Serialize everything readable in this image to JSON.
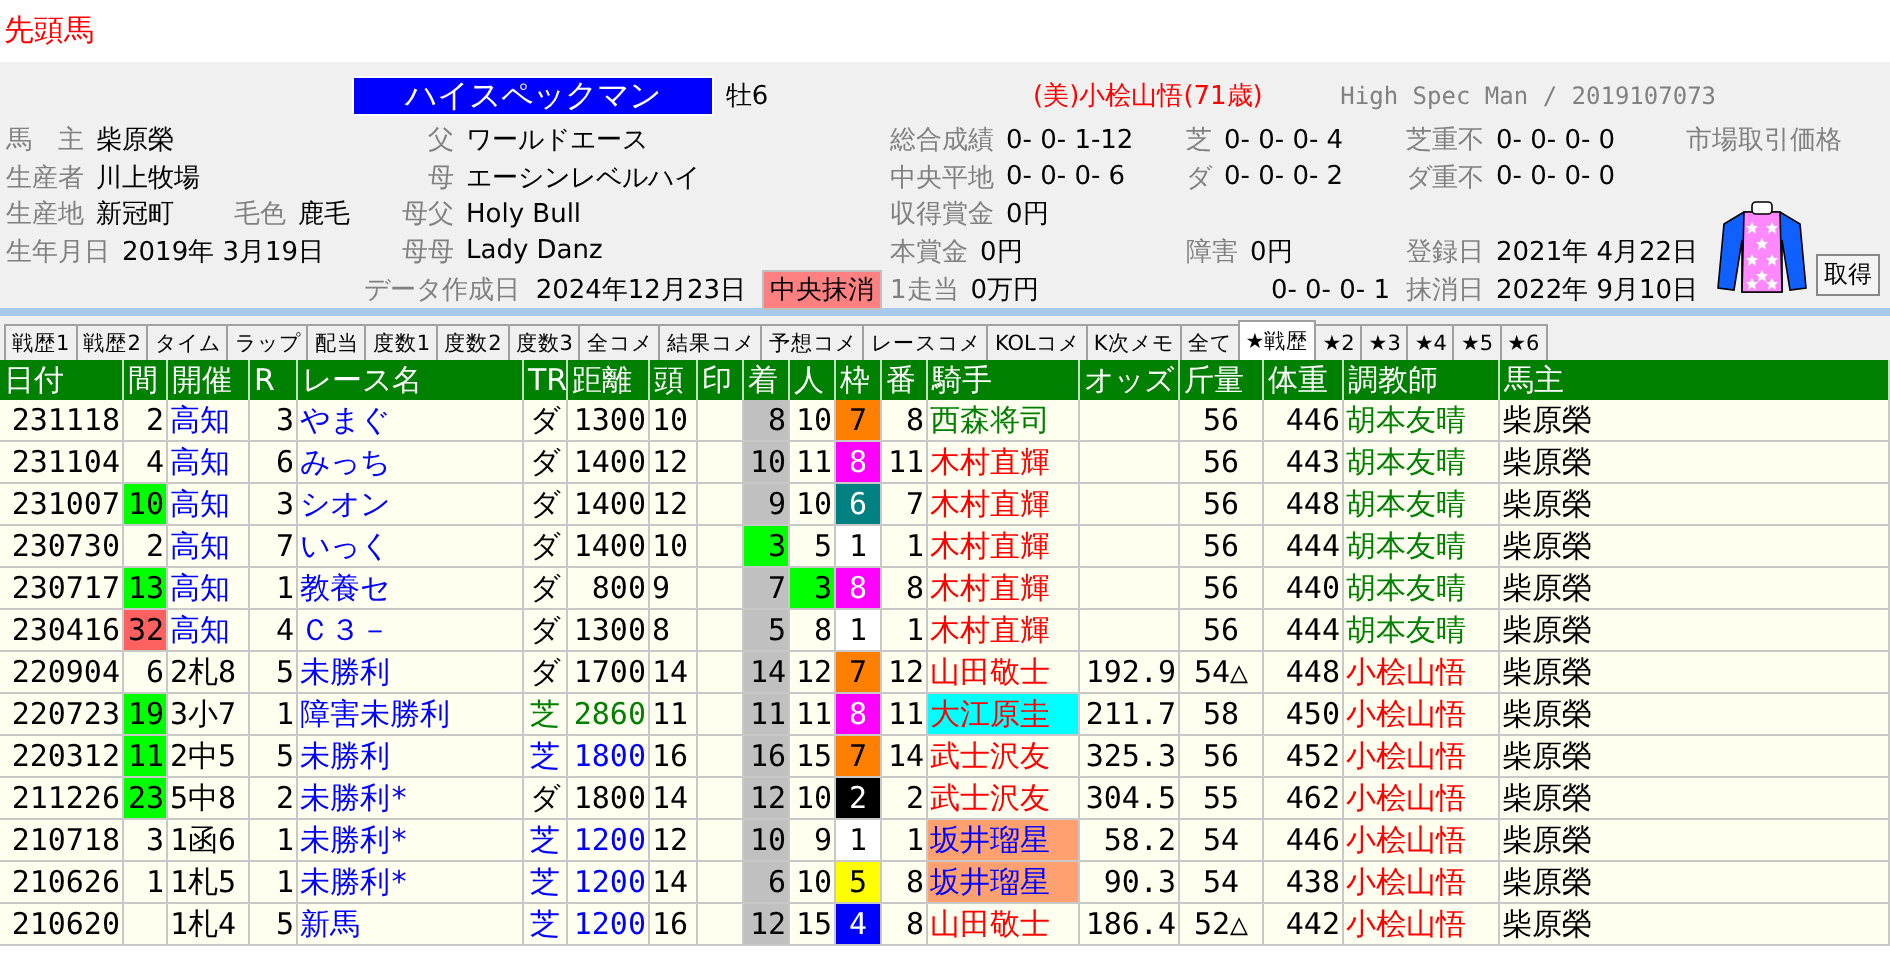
{
  "title": "先頭馬",
  "horse": {
    "name": "ハイスペックマン",
    "sex_age": "牡6",
    "trainer": "(美)小桧山悟(71歳)",
    "english": "High Spec Man / 2019107073"
  },
  "info_rows": [
    [
      {
        "label": "馬　主",
        "value": "柴原榮"
      },
      {
        "label": "父",
        "value": "ワールドエース"
      },
      {
        "label": "総合成績",
        "value": "0- 0- 1-12"
      },
      {
        "label": "芝",
        "value": "0- 0- 0- 4"
      },
      {
        "label": "芝重不",
        "value": "0- 0- 0- 0"
      },
      {
        "label": "市場取引価格"
      }
    ],
    [
      {
        "label": "生産者",
        "value": "川上牧場"
      },
      {
        "label": "母",
        "value": "エーシンレベルハイ"
      },
      {
        "label": "中央平地",
        "value": "0- 0- 0- 6"
      },
      {
        "label": "ダ",
        "value": "0- 0- 0- 2"
      },
      {
        "label": "ダ重不",
        "value": "0- 0- 0- 0"
      }
    ],
    [
      {
        "label": "生産地",
        "value": "新冠町",
        "label2": "毛色",
        "value2": "鹿毛"
      },
      {
        "label": "母父",
        "value": "Holy Bull"
      },
      {
        "label": "収得賞金",
        "value": "0円"
      }
    ],
    [
      {
        "label": "生年月日",
        "value": "2019年 3月19日"
      },
      {
        "label": "母母",
        "value": "Lady Danz"
      },
      {
        "label": "本賞金",
        "value": "0円"
      },
      {
        "label": "障害",
        "value": "0円"
      },
      {
        "label": "登録日",
        "value": "2021年 4月22日"
      }
    ]
  ],
  "data_date": {
    "label": "データ作成日",
    "value": "2024年12月23日",
    "status": "中央抹消"
  },
  "last_row": [
    {
      "label": "1走当",
      "value": "0万円"
    },
    {
      "value": "0- 0- 0- 1"
    },
    {
      "label": "抹消日",
      "value": "2022年 9月10日"
    }
  ],
  "fetch_button": "取得",
  "tabs": [
    {
      "label": "戦歴1",
      "selected": false
    },
    {
      "label": "戦歴2",
      "selected": false
    },
    {
      "label": "タイム",
      "selected": false
    },
    {
      "label": "ラップ",
      "selected": false
    },
    {
      "label": "配当",
      "selected": false
    },
    {
      "label": "度数1",
      "selected": false
    },
    {
      "label": "度数2",
      "selected": false
    },
    {
      "label": "度数3",
      "selected": false
    },
    {
      "label": "全コメ",
      "selected": false
    },
    {
      "label": "結果コメ",
      "selected": false
    },
    {
      "label": "予想コメ",
      "selected": false
    },
    {
      "label": "レースコメ",
      "selected": false
    },
    {
      "label": "KOLコメ",
      "selected": false
    },
    {
      "label": "K次メモ",
      "selected": false
    },
    {
      "label": "全て",
      "selected": false
    },
    {
      "label": "★戦歴",
      "selected": true
    },
    {
      "label": "★2",
      "selected": false
    },
    {
      "label": "★3",
      "selected": false
    },
    {
      "label": "★4",
      "selected": false
    },
    {
      "label": "★5",
      "selected": false
    },
    {
      "label": "★6",
      "selected": false
    }
  ],
  "columns": [
    "日付",
    "間",
    "開催",
    "R",
    "レース名",
    "TR",
    "距離",
    "頭",
    "印",
    "着",
    "人",
    "枠",
    "番",
    "騎手",
    "オッズ",
    "斤量",
    "体重",
    "調教師",
    "馬主"
  ],
  "rows": [
    {
      "date": "231118",
      "gap": {
        "text": "2"
      },
      "venue": {
        "text": "高知",
        "color": "#0000ff"
      },
      "race_no": "3",
      "race_name": "やまぐ",
      "track": {
        "text": "ダ",
        "color": "#000000"
      },
      "distance": {
        "text": "1300",
        "color": "#000000"
      },
      "runners": "10",
      "finish": {
        "text": "8",
        "color": "#c0c0c0"
      },
      "popularity": {
        "text": "10"
      },
      "frame": {
        "text": "7",
        "color": "#ff8000"
      },
      "horse_no": "8",
      "jockey": {
        "text": "西森将司",
        "color": "#008000"
      },
      "weight": "56",
      "body_weight": "446",
      "trainer": {
        "text": "胡本友晴",
        "color": "#008000"
      },
      "owner": "柴原榮"
    },
    {
      "date": "231104",
      "gap": {
        "text": "4"
      },
      "venue": {
        "text": "高知",
        "color": "#0000ff"
      },
      "race_no": "6",
      "race_name": "みっち",
      "track": {
        "text": "ダ",
        "color": "#000000"
      },
      "distance": {
        "text": "1400",
        "color": "#000000"
      },
      "runners": "12",
      "finish": {
        "text": "10",
        "color": "#c0c0c0"
      },
      "popularity": {
        "text": "11"
      },
      "frame": {
        "text": "8",
        "color": "#ff00ff"
      },
      "horse_no": "11",
      "jockey": {
        "text": "木村直輝",
        "color": "#ff0000"
      },
      "weight": "56",
      "body_weight": "443",
      "trainer": {
        "text": "胡本友晴",
        "color": "#008000"
      },
      "owner": "柴原榮"
    },
    {
      "date": "231007",
      "gap": {
        "text": "10",
        "color": "#00ff00"
      },
      "venue": {
        "text": "高知",
        "color": "#0000ff"
      },
      "race_no": "3",
      "race_name": "シオン",
      "track": {
        "text": "ダ",
        "color": "#000000"
      },
      "distance": {
        "text": "1400",
        "color": "#000000"
      },
      "runners": "12",
      "finish": {
        "text": "9",
        "color": "#c0c0c0"
      },
      "popularity": {
        "text": "10"
      },
      "frame": {
        "text": "6",
        "color": "#008080"
      },
      "horse_no": "7",
      "jockey": {
        "text": "木村直輝",
        "color": "#ff0000"
      },
      "weight": "56",
      "body_weight": "448",
      "trainer": {
        "text": "胡本友晴",
        "color": "#008000"
      },
      "owner": "柴原榮"
    },
    {
      "date": "230730",
      "gap": {
        "text": "2"
      },
      "venue": {
        "text": "高知",
        "color": "#0000ff"
      },
      "race_no": "7",
      "race_name": "いっく",
      "track": {
        "text": "ダ",
        "color": "#000000"
      },
      "distance": {
        "text": "1400",
        "color": "#000000"
      },
      "runners": "10",
      "finish": {
        "text": "3",
        "color": "#00ff00"
      },
      "popularity": {
        "text": "5"
      },
      "frame": {
        "text": "1",
        "color": "#ffffff"
      },
      "horse_no": "1",
      "jockey": {
        "text": "木村直輝",
        "color": "#ff0000"
      },
      "weight": "56",
      "body_weight": "444",
      "trainer": {
        "text": "胡本友晴",
        "color": "#008000"
      },
      "owner": "柴原榮"
    },
    {
      "date": "230717",
      "gap": {
        "text": "13",
        "color": "#00ff00"
      },
      "venue": {
        "text": "高知",
        "color": "#0000ff"
      },
      "race_no": "1",
      "race_name": "教養セ",
      "track": {
        "text": "ダ",
        "color": "#000000"
      },
      "distance": {
        "text": "800",
        "color": "#000000"
      },
      "runners": "9",
      "finish": {
        "text": "7",
        "color": "#c0c0c0"
      },
      "popularity": {
        "text": "3",
        "color": "#00ff00"
      },
      "frame": {
        "text": "8",
        "color": "#ff00ff"
      },
      "horse_no": "8",
      "jockey": {
        "text": "木村直輝",
        "color": "#ff0000"
      },
      "weight": "56",
      "body_weight": "440",
      "trainer": {
        "text": "胡本友晴",
        "color": "#008000"
      },
      "owner": "柴原榮"
    },
    {
      "date": "230416",
      "gap": {
        "text": "32",
        "color": "#ff6060"
      },
      "venue": {
        "text": "高知",
        "color": "#0000ff"
      },
      "race_no": "4",
      "race_name": "Ｃ３－",
      "track": {
        "text": "ダ",
        "color": "#000000"
      },
      "distance": {
        "text": "1300",
        "color": "#000000"
      },
      "runners": "8",
      "finish": {
        "text": "5",
        "color": "#c0c0c0"
      },
      "popularity": {
        "text": "8"
      },
      "frame": {
        "text": "1",
        "color": "#ffffff"
      },
      "horse_no": "1",
      "jockey": {
        "text": "木村直輝",
        "color": "#ff0000"
      },
      "weight": "56",
      "body_weight": "444",
      "trainer": {
        "text": "胡本友晴",
        "color": "#008000"
      },
      "owner": "柴原榮"
    },
    {
      "date": "220904",
      "gap": {
        "text": "6"
      },
      "venue": {
        "text": "2札8",
        "color": "#000000"
      },
      "race_no": "5",
      "race_name": "未勝利",
      "track": {
        "text": "ダ",
        "color": "#000000"
      },
      "distance": {
        "text": "1700",
        "color": "#000000"
      },
      "runners": "14",
      "finish": {
        "text": "14",
        "color": "#c0c0c0"
      },
      "popularity": {
        "text": "12"
      },
      "frame": {
        "text": "7",
        "color": "#ff8000"
      },
      "horse_no": "12",
      "jockey": {
        "text": "山田敬士",
        "color": "#ff0000"
      },
      "odds": "192.9",
      "weight": "54△",
      "body_weight": "448",
      "trainer": {
        "text": "小桧山悟",
        "color": "#ff0000"
      },
      "owner": "柴原榮"
    },
    {
      "date": "220723",
      "gap": {
        "text": "19",
        "color": "#00ff00"
      },
      "venue": {
        "text": "3小7",
        "color": "#000000"
      },
      "race_no": "1",
      "race_name": "障害未勝利",
      "track": {
        "text": "芝",
        "color": "#008000"
      },
      "distance": {
        "text": "2860",
        "color": "#008000"
      },
      "runners": "11",
      "finish": {
        "text": "11",
        "color": "#c0c0c0"
      },
      "popularity": {
        "text": "11"
      },
      "frame": {
        "text": "8",
        "color": "#ff00ff"
      },
      "horse_no": "11",
      "jockey": {
        "text": "大江原圭",
        "color": "#ff0000",
        "highlight": {
          "color": "#00ffff"
        }
      },
      "odds": "211.7",
      "weight": "58",
      "body_weight": "450",
      "trainer": {
        "text": "小桧山悟",
        "color": "#ff0000"
      },
      "owner": "柴原榮"
    },
    {
      "date": "220312",
      "gap": {
        "text": "11",
        "color": "#00ff00"
      },
      "venue": {
        "text": "2中5",
        "color": "#000000"
      },
      "race_no": "5",
      "race_name": "未勝利",
      "track": {
        "text": "芝",
        "color": "#0000ff"
      },
      "distance": {
        "text": "1800",
        "color": "#0000ff"
      },
      "runners": "16",
      "finish": {
        "text": "16",
        "color": "#c0c0c0"
      },
      "popularity": {
        "text": "15"
      },
      "frame": {
        "text": "7",
        "color": "#ff8000"
      },
      "horse_no": "14",
      "jockey": {
        "text": "武士沢友",
        "color": "#ff0000"
      },
      "odds": "325.3",
      "weight": "56",
      "body_weight": "452",
      "trainer": {
        "text": "小桧山悟",
        "color": "#ff0000"
      },
      "owner": "柴原榮"
    },
    {
      "date": "211226",
      "gap": {
        "text": "23",
        "color": "#00ff00"
      },
      "venue": {
        "text": "5中8",
        "color": "#000000"
      },
      "race_no": "2",
      "race_name": "未勝利*",
      "track": {
        "text": "ダ",
        "color": "#000000"
      },
      "distance": {
        "text": "1800",
        "color": "#000000"
      },
      "runners": "14",
      "finish": {
        "text": "12",
        "color": "#c0c0c0"
      },
      "popularity": {
        "text": "10"
      },
      "frame": {
        "text": "2",
        "color": "#000000"
      },
      "horse_no": "2",
      "jockey": {
        "text": "武士沢友",
        "color": "#ff0000"
      },
      "odds": "304.5",
      "weight": "55",
      "body_weight": "462",
      "trainer": {
        "text": "小桧山悟",
        "color": "#ff0000"
      },
      "owner": "柴原榮"
    },
    {
      "date": "210718",
      "gap": {
        "text": "3"
      },
      "venue": {
        "text": "1函6",
        "color": "#000000"
      },
      "race_no": "1",
      "race_name": "未勝利*",
      "track": {
        "text": "芝",
        "color": "#0000ff"
      },
      "distance": {
        "text": "1200",
        "color": "#0000ff"
      },
      "runners": "12",
      "finish": {
        "text": "10",
        "color": "#c0c0c0"
      },
      "popularity": {
        "text": "9"
      },
      "frame": {
        "text": "1",
        "color": "#ffffff"
      },
      "horse_no": "1",
      "jockey": {
        "text": "坂井瑠星",
        "color": "#0000ff",
        "highlight": {
          "color": "#ffa070"
        }
      },
      "odds": "58.2",
      "weight": "54",
      "body_weight": "446",
      "trainer": {
        "text": "小桧山悟",
        "color": "#ff0000"
      },
      "owner": "柴原榮"
    },
    {
      "date": "210626",
      "gap": {
        "text": "1"
      },
      "venue": {
        "text": "1札5",
        "color": "#000000"
      },
      "race_no": "1",
      "race_name": "未勝利*",
      "track": {
        "text": "芝",
        "color": "#0000ff"
      },
      "distance": {
        "text": "1200",
        "color": "#0000ff"
      },
      "runners": "14",
      "finish": {
        "text": "6",
        "color": "#c0c0c0"
      },
      "popularity": {
        "text": "10"
      },
      "frame": {
        "text": "5",
        "color": "#ffff00"
      },
      "horse_no": "8",
      "jockey": {
        "text": "坂井瑠星",
        "color": "#0000ff",
        "highlight": {
          "color": "#ffa070"
        }
      },
      "odds": "90.3",
      "weight": "54",
      "body_weight": "438",
      "trainer": {
        "text": "小桧山悟",
        "color": "#ff0000"
      },
      "owner": "柴原榮"
    },
    {
      "date": "210620",
      "venue": {
        "text": "1札4",
        "color": "#000000"
      },
      "race_no": "5",
      "race_name": "新馬",
      "track": {
        "text": "芝",
        "color": "#0000ff"
      },
      "distance": {
        "text": "1200",
        "color": "#0000ff"
      },
      "runners": "16",
      "finish": {
        "text": "12",
        "color": "#c0c0c0"
      },
      "popularity": {
        "text": "15"
      },
      "frame": {
        "text": "4",
        "color": "#0000ff"
      },
      "horse_no": "8",
      "jockey": {
        "text": "山田敬士",
        "color": "#ff0000"
      },
      "odds": "186.4",
      "weight": "52△",
      "body_weight": "442",
      "trainer": {
        "text": "小桧山悟",
        "color": "#ff0000"
      },
      "owner": "柴原榮"
    }
  ]
}
